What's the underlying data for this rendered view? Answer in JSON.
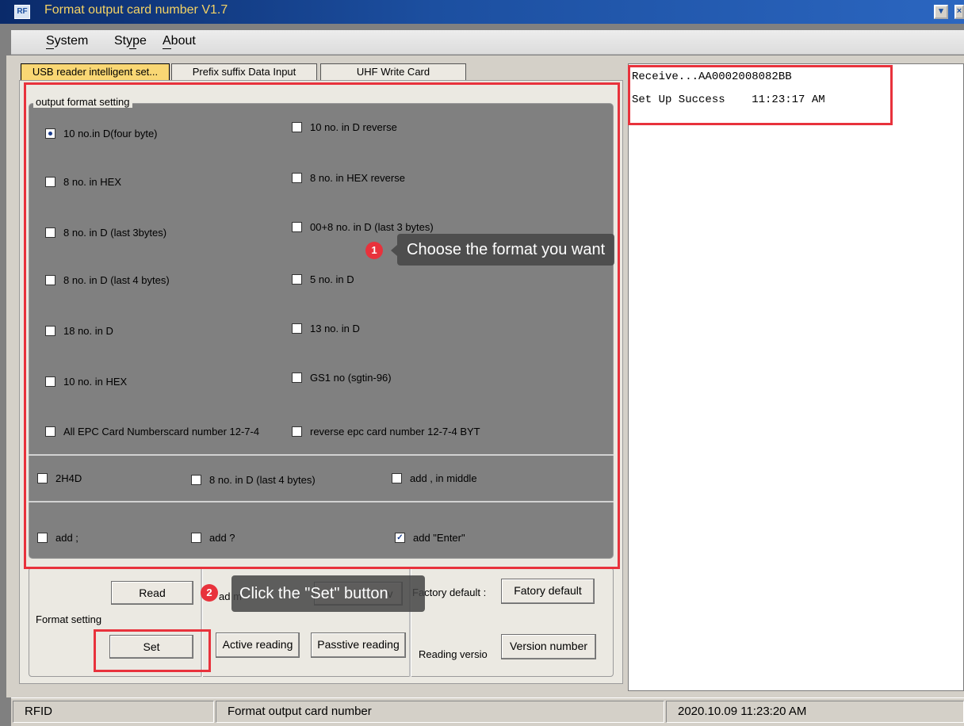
{
  "window": {
    "title": "Format output  card number V1.7",
    "app_icon": "app-icon",
    "controls": [
      "minimize",
      "close"
    ]
  },
  "menu": {
    "items": [
      "System",
      "Stype",
      "About"
    ],
    "mnemonics": [
      "S",
      "y",
      "A"
    ]
  },
  "tabs": [
    {
      "label": "USB reader intelligent set...",
      "active": true
    },
    {
      "label": "Prefix suffix Data Input",
      "active": false
    },
    {
      "label": "UHF Write Card",
      "active": false
    }
  ],
  "output_format": {
    "legend": "output format setting",
    "selected": "10 no.in D(four byte)",
    "left_column": [
      "10 no.in D(four byte)",
      "8 no. in HEX",
      " 8 no. in D (last 3bytes)",
      "8 no. in D (last 4 bytes)",
      "18 no. in D",
      "10 no. in HEX",
      "All EPC Card Numberscard number 12-7-4"
    ],
    "right_column": [
      "10 no. in D reverse",
      "8 no. in HEX reverse",
      "00+8 no. in D (last 3 bytes)",
      "5 no. in D",
      "13 no. in D",
      "GS1 no (sgtin-96)",
      "reverse epc card number 12-7-4 BYT"
    ],
    "extras_row1": [
      "2H4D",
      "8 no. in D (last 4 bytes)",
      "add , in middle"
    ],
    "extras_row2": [
      "add ;",
      "add ?",
      "add \"Enter\""
    ],
    "extras_checked": "add \"Enter\""
  },
  "format_setting": {
    "read_button": "Read",
    "label": "Format setting",
    "set_button": "Set",
    "read_mode_label_fragment": "ad m",
    "mode_value_fragment": "v",
    "active_reading_button": "Active reading",
    "passive_reading_button": "Passtive reading",
    "factory_default_label": "Factory default :",
    "factory_default_button": "Fatory default",
    "reading_version_label": "Reading versio",
    "version_button": "Version number"
  },
  "output_log": {
    "lines": [
      "Receive...AA0002008082BB",
      "Set Up Success    11:23:17 AM"
    ]
  },
  "annotations": {
    "step1": {
      "number": "1",
      "text": "Choose the format you want"
    },
    "step2": {
      "number": "2",
      "text": "Click the \"Set\" button"
    },
    "highlight_color": "#e8323c"
  },
  "statusbar": {
    "left": "RFID",
    "center": "Format output  card number",
    "right": "2020.10.09   11:23:20 AM"
  },
  "colors": {
    "title_text": "#f4d264",
    "active_tab": "#f9d774",
    "highlight": "#e8323c"
  }
}
